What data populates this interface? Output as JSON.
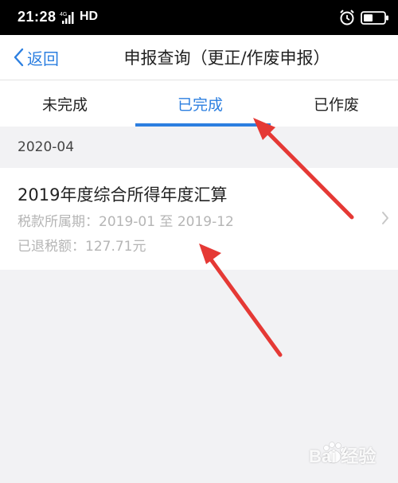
{
  "status_bar": {
    "time": "21:28",
    "network": "4G",
    "hd": "HD",
    "icons": [
      "signal-icon",
      "alarm-icon",
      "battery-icon"
    ]
  },
  "nav": {
    "back_label": "返回",
    "title": "申报查询（更正/作废申报）"
  },
  "tabs": [
    {
      "label": "未完成",
      "active": false
    },
    {
      "label": "已完成",
      "active": true
    },
    {
      "label": "已作废",
      "active": false
    }
  ],
  "section": {
    "date": "2020-04"
  },
  "record": {
    "title": "2019年度综合所得年度汇算",
    "period": "税款所属期：2019-01 至 2019-12",
    "refund": "已退税额：127.71元"
  },
  "watermark": {
    "text": "Bai 经验",
    "logo": "baidu-paw-logo"
  },
  "colors": {
    "accent": "#2c7fe0",
    "annotation_arrow": "#e53935",
    "page_background": "#f2f2f4",
    "secondary_text": "#b5b5b5"
  }
}
